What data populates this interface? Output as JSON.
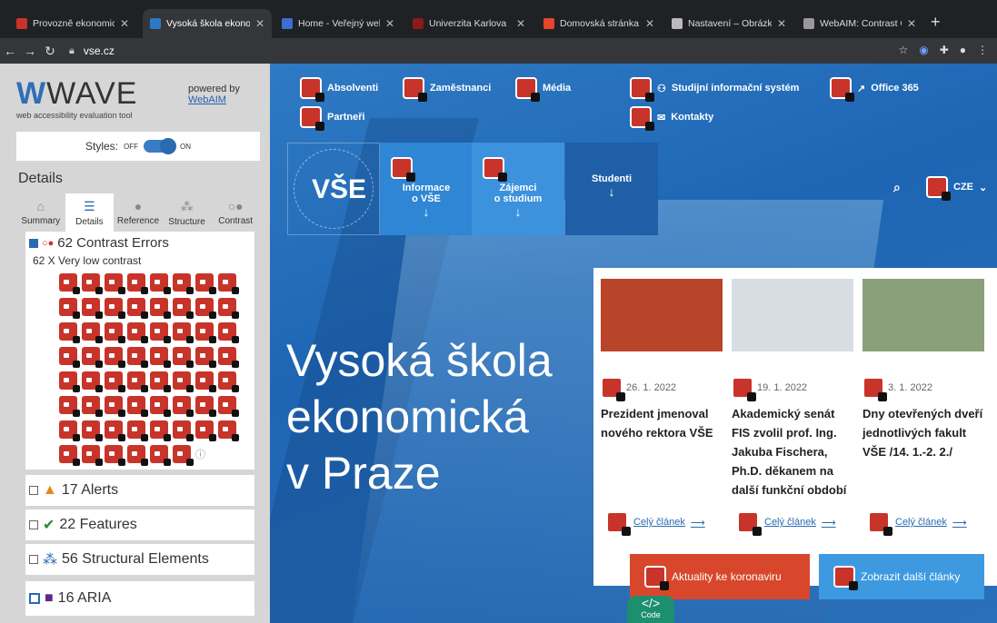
{
  "browser": {
    "tabs": [
      {
        "label": "Provozně ekonomická fa",
        "fav": "#c8342a"
      },
      {
        "label": "Vysoká škola ekonomická",
        "fav": "#2a7ac4"
      },
      {
        "label": "Home - Veřejný web",
        "fav": "#3b6fd1"
      },
      {
        "label": "Univerzita Karlova",
        "fav": "#8b1a1a"
      },
      {
        "label": "Domovská stránka - V",
        "fav": "#e8452c"
      },
      {
        "label": "Nastavení – Obrázky",
        "fav": "#bbbbbb"
      },
      {
        "label": "WebAIM: Contrast Ch",
        "fav": "#999999"
      }
    ],
    "url": "vse.cz"
  },
  "wave": {
    "logo": "WAVE",
    "subtitle": "web accessibility evaluation tool",
    "powered_by": "powered by",
    "webaim": "WebAIM",
    "styles_label": "Styles:",
    "off": "OFF",
    "on": "ON",
    "details_heading": "Details",
    "tabs": [
      "Summary",
      "Details",
      "Reference",
      "Structure",
      "Contrast"
    ],
    "contrast_errors": "62 Contrast Errors",
    "very_low_contrast": "62 X Very low contrast",
    "error_icon_count": 62,
    "alerts": "17 Alerts",
    "features": "22 Features",
    "structural": "56 Structural Elements",
    "aria": "16 ARIA"
  },
  "site": {
    "toplinks": [
      "Absolventi",
      "Zaměstnanci",
      "Média",
      "Studijní informační systém",
      "Office 365",
      "Partneři",
      "Kontakty"
    ],
    "nav": [
      {
        "label1": "Informace",
        "label2": "o VŠE"
      },
      {
        "label1": "Zájemci",
        "label2": "o studium"
      },
      {
        "label1": "Studenti",
        "label2": ""
      }
    ],
    "lang": "CZE",
    "logo_text": "VŠE",
    "hero": [
      "Vysoká škola",
      "ekonomická",
      "v Praze"
    ],
    "news": [
      {
        "date": "26. 1. 2022",
        "title": "Prezident jmenoval nového rektora VŠE",
        "img": "#b8452a"
      },
      {
        "date": "19. 1. 2022",
        "title": "Akademický senát FIS zvolil prof. Ing. Jakuba Fischera, Ph.D. děkanem na další funkční období",
        "img": "#d8dde3"
      },
      {
        "date": "3. 1. 2022",
        "title": "Dny otevřených dveří jednotlivých fakult VŠE /14. 1.-2. 2./",
        "img": "#8aa07a"
      }
    ],
    "more_label": "Celý článek",
    "corona_btn": "Aktuality ke koronaviru",
    "more_articles_btn": "Zobrazit další články",
    "code_badge": "</>",
    "code_label": "Code"
  }
}
